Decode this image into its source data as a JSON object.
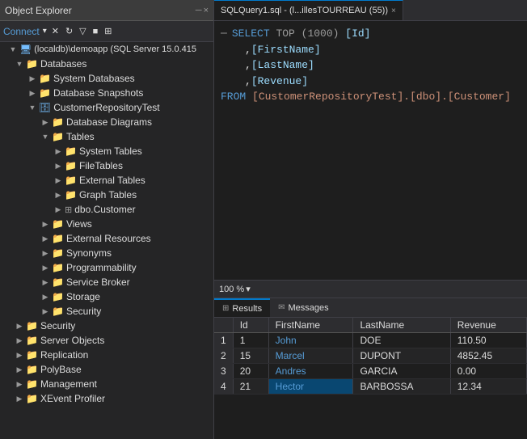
{
  "objectExplorer": {
    "title": "Object Explorer",
    "connectLabel": "Connect",
    "tree": [
      {
        "id": "server",
        "label": "(localdb)\\demoapp (SQL Server 15.0.415",
        "indent": 0,
        "expanded": true,
        "icon": "server",
        "type": "server"
      },
      {
        "id": "databases",
        "label": "Databases",
        "indent": 1,
        "expanded": true,
        "icon": "folder",
        "type": "folder"
      },
      {
        "id": "sysdb",
        "label": "System Databases",
        "indent": 2,
        "expanded": false,
        "icon": "folder",
        "type": "folder"
      },
      {
        "id": "snapshots",
        "label": "Database Snapshots",
        "indent": 2,
        "expanded": false,
        "icon": "folder",
        "type": "folder"
      },
      {
        "id": "custdb",
        "label": "CustomerRepositoryTest",
        "indent": 2,
        "expanded": true,
        "icon": "database",
        "type": "database"
      },
      {
        "id": "diagrams",
        "label": "Database Diagrams",
        "indent": 3,
        "expanded": false,
        "icon": "folder",
        "type": "folder"
      },
      {
        "id": "tables",
        "label": "Tables",
        "indent": 3,
        "expanded": true,
        "icon": "folder",
        "type": "folder"
      },
      {
        "id": "systables",
        "label": "System Tables",
        "indent": 4,
        "expanded": false,
        "icon": "folder",
        "type": "folder"
      },
      {
        "id": "filetables",
        "label": "FileTables",
        "indent": 4,
        "expanded": false,
        "icon": "folder",
        "type": "folder"
      },
      {
        "id": "exttables",
        "label": "External Tables",
        "indent": 4,
        "expanded": false,
        "icon": "folder",
        "type": "folder"
      },
      {
        "id": "graphtables",
        "label": "Graph Tables",
        "indent": 4,
        "expanded": false,
        "icon": "folder",
        "type": "folder"
      },
      {
        "id": "customer",
        "label": "dbo.Customer",
        "indent": 4,
        "expanded": false,
        "icon": "table",
        "type": "table"
      },
      {
        "id": "views",
        "label": "Views",
        "indent": 3,
        "expanded": false,
        "icon": "folder",
        "type": "folder"
      },
      {
        "id": "extresources",
        "label": "External Resources",
        "indent": 3,
        "expanded": false,
        "icon": "folder",
        "type": "folder"
      },
      {
        "id": "synonyms",
        "label": "Synonyms",
        "indent": 3,
        "expanded": false,
        "icon": "folder",
        "type": "folder"
      },
      {
        "id": "programmability",
        "label": "Programmability",
        "indent": 3,
        "expanded": false,
        "icon": "folder",
        "type": "folder"
      },
      {
        "id": "servicebroker",
        "label": "Service Broker",
        "indent": 3,
        "expanded": false,
        "icon": "folder",
        "type": "folder"
      },
      {
        "id": "storage",
        "label": "Storage",
        "indent": 3,
        "expanded": false,
        "icon": "folder",
        "type": "folder"
      },
      {
        "id": "security_db",
        "label": "Security",
        "indent": 3,
        "expanded": false,
        "icon": "folder",
        "type": "folder"
      },
      {
        "id": "security_top",
        "label": "Security",
        "indent": 1,
        "expanded": false,
        "icon": "folder",
        "type": "folder"
      },
      {
        "id": "serverobjects",
        "label": "Server Objects",
        "indent": 1,
        "expanded": false,
        "icon": "folder",
        "type": "folder"
      },
      {
        "id": "replication",
        "label": "Replication",
        "indent": 1,
        "expanded": false,
        "icon": "folder",
        "type": "folder"
      },
      {
        "id": "polybase",
        "label": "PolyBase",
        "indent": 1,
        "expanded": false,
        "icon": "folder",
        "type": "folder"
      },
      {
        "id": "management",
        "label": "Management",
        "indent": 1,
        "expanded": false,
        "icon": "folder",
        "type": "folder"
      },
      {
        "id": "xevent",
        "label": "XEvent Profiler",
        "indent": 1,
        "expanded": false,
        "icon": "folder",
        "type": "folder"
      }
    ]
  },
  "editor": {
    "tab": {
      "label": "SQLQuery1.sql - (l...illesTOURREAU (55))",
      "closeBtn": "×"
    },
    "code": {
      "line1_kw": "SELECT",
      "line1_top": "TOP (1000)",
      "line1_col": "[Id]",
      "line2_col": "[FirstName]",
      "line3_col": "[LastName]",
      "line4_col": "[Revenue]",
      "line5_kw": "FROM",
      "line5_table": "[CustomerRepositoryTest].[dbo].[Customer]"
    },
    "zoom": "100 %"
  },
  "results": {
    "tabs": [
      {
        "label": "Results",
        "active": true
      },
      {
        "label": "Messages",
        "active": false
      }
    ],
    "columns": [
      "",
      "Id",
      "FirstName",
      "LastName",
      "Revenue"
    ],
    "rows": [
      {
        "rowNum": "1",
        "id": "1",
        "firstName": "John",
        "lastName": "DOE",
        "revenue": "110.50",
        "revenueClass": "val-blue",
        "selected": false
      },
      {
        "rowNum": "2",
        "id": "15",
        "firstName": "Marcel",
        "lastName": "DUPONT",
        "revenue": "4852.45",
        "revenueClass": "val-blue",
        "selected": false
      },
      {
        "rowNum": "3",
        "id": "20",
        "firstName": "Andres",
        "lastName": "GARCIA",
        "revenue": "0.00",
        "revenueClass": "val-red",
        "selected": false
      },
      {
        "rowNum": "4",
        "id": "21",
        "firstName": "Hector",
        "lastName": "BARBOSSA",
        "revenue": "12.34",
        "revenueClass": "val-blue",
        "selected": true
      }
    ]
  }
}
